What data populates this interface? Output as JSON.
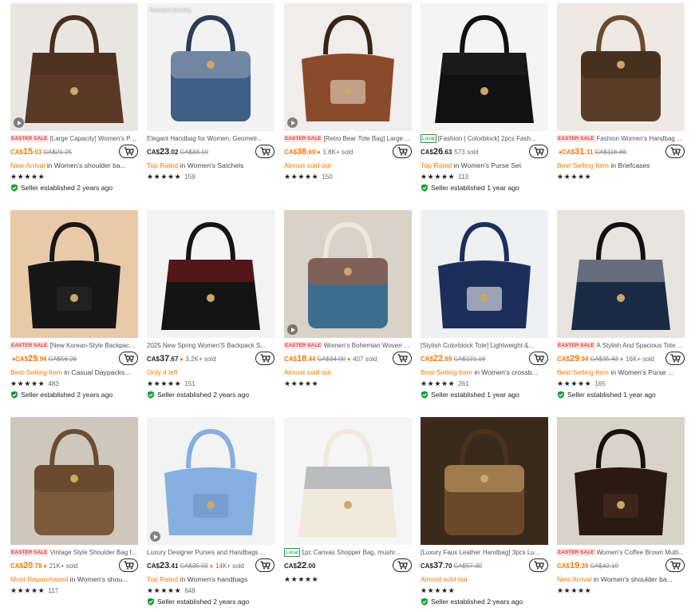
{
  "currency": "CA$",
  "colors": {
    "accent": "#fb7701",
    "sale": "#e4393c",
    "local": "#1a9b3a"
  },
  "products": [
    {
      "title": "[Large Capacity] Women's PU...",
      "badge": "EASTER SALE",
      "price_int": "15",
      "price_dec": ".03",
      "price_color": "orange",
      "orig": "CA$21.25",
      "sold": "",
      "flame": false,
      "ribbon_hl": "New Arrival",
      "ribbon_cat": " in Women's shoulder ba...",
      "reviews": "",
      "seller": "Seller established 2 years ago",
      "overlay": "",
      "video": true,
      "img": {
        "bg": "#e9e6e2",
        "bag": "#5a3a26",
        "pattern": "#3a2518",
        "handle": "#4a2e1e"
      }
    },
    {
      "title": "Elegant Handbag for Women, Geometr...",
      "badge": "",
      "price_int": "23",
      "price_dec": ".02",
      "price_color": "dark",
      "orig": "CA$33.10",
      "sold": "",
      "flame": false,
      "ribbon_hl": "Top Rated",
      "ribbon_cat": " in Women's Satchels",
      "reviews": "159",
      "seller": "",
      "overlay": "Random printing",
      "video": false,
      "img": {
        "bg": "#f2f2f2",
        "bag": "#3f5f86",
        "pattern": "#9aa7b8",
        "handle": "#2c3e55"
      }
    },
    {
      "title": "[Retro Bear Tote Bag] Large C...",
      "badge": "EASTER SALE",
      "price_int": "38",
      "price_dec": ".60",
      "price_color": "orange",
      "orig": "",
      "sold": "1.8K+ sold",
      "flame": true,
      "ribbon_hl": "Almost sold out",
      "ribbon_cat": "",
      "reviews": "150",
      "seller": "",
      "overlay": "",
      "video": true,
      "img": {
        "bg": "#efeeec",
        "bag": "#8a4b2c",
        "pattern": "#e6d9c5",
        "handle": "#3a2418"
      }
    },
    {
      "title": "[Fashion | Colorblock] 2pcs Fash...",
      "badge": "Local",
      "price_int": "26",
      "price_dec": ".63",
      "price_color": "dark",
      "orig": "",
      "sold": "573 sold",
      "flame": false,
      "ribbon_hl": "Top Rated",
      "ribbon_cat": " in Women's Purse Set",
      "reviews": "113",
      "seller": "Seller established 1 year ago",
      "overlay": "",
      "video": false,
      "img": {
        "bg": "#f4f4f4",
        "bag": "#111111",
        "pattern": "#2a2a2a",
        "handle": "#111111"
      }
    },
    {
      "title": "Fashion Women's Handbag S...",
      "badge": "EASTER SALE",
      "price_int": "31",
      "price_dec": ".31",
      "price_color": "orange",
      "orig": "CA$116.86",
      "sold": "",
      "flame": true,
      "ribbon_hl": "Best-Selling Item",
      "ribbon_cat": " in Briefcases",
      "reviews": "",
      "seller": "",
      "overlay": "",
      "video": false,
      "img": {
        "bg": "#efe9e3",
        "bag": "#5a3d28",
        "pattern": "#3b2718",
        "handle": "#6a4a30"
      }
    },
    {
      "title": "[New Korean-Style Backpack]...",
      "badge": "EASTER SALE",
      "price_int": "25",
      "price_dec": ".94",
      "price_color": "orange",
      "orig": "CA$56.26",
      "sold": "",
      "flame": true,
      "ribbon_hl": "Best-Selling Item",
      "ribbon_cat": " in Casual Daypacks...",
      "reviews": "483",
      "seller": "Seller established 2 years ago",
      "overlay": "",
      "video": false,
      "img": {
        "bg": "#e8c9a8",
        "bag": "#161616",
        "pattern": "#2a2a2a",
        "handle": "#161616"
      }
    },
    {
      "title": "2025 New Spring Women'S Backpack S...",
      "badge": "",
      "price_int": "37",
      "price_dec": ".67",
      "price_color": "dark",
      "orig": "",
      "sold": "3.2K+ sold",
      "flame": true,
      "ribbon_hl": "Only 4 left",
      "ribbon_cat": "",
      "reviews": "151",
      "seller": "Seller established 2 years ago",
      "overlay": "",
      "video": false,
      "img": {
        "bg": "#f3f3f3",
        "bag": "#141414",
        "pattern": "#c81e1e",
        "handle": "#141414"
      }
    },
    {
      "title": "Women's Bohemian Woven S...",
      "badge": "EASTER SALE",
      "price_int": "18",
      "price_dec": ".44",
      "price_color": "orange",
      "orig": "CA$34.00",
      "sold": "407 sold",
      "flame": true,
      "ribbon_hl": "Almost sold out",
      "ribbon_cat": "",
      "reviews": "",
      "seller": "",
      "overlay": "",
      "video": true,
      "img": {
        "bg": "#d8d2c8",
        "bag": "#3c6e8f",
        "pattern": "#b5552e",
        "handle": "#efe8da"
      }
    },
    {
      "title": "[Stylish Colorblock Tote] Lightweight &...",
      "badge": "",
      "price_int": "22",
      "price_dec": ".89",
      "price_color": "orange",
      "orig": "CA$121.16",
      "sold": "",
      "flame": false,
      "ribbon_hl": "Best-Selling Item",
      "ribbon_cat": " in Women's crossb...",
      "reviews": "261",
      "seller": "Seller established 1 year ago",
      "overlay": "",
      "video": false,
      "img": {
        "bg": "#eef0f2",
        "bag": "#1c2f5a",
        "pattern": "#f2f2f2",
        "handle": "#1c2f5a"
      }
    },
    {
      "title": "A Stylish And Spacious Tote ...",
      "badge": "EASTER SALE",
      "price_int": "29",
      "price_dec": ".94",
      "price_color": "orange",
      "orig": "CA$35.43",
      "sold": "16K+ sold",
      "flame": true,
      "ribbon_hl": "Best-Selling Item",
      "ribbon_cat": " in Women's Purse ...",
      "reviews": "165",
      "seller": "Seller established 1 year ago",
      "overlay": "",
      "video": false,
      "img": {
        "bg": "#e7e3de",
        "bag": "#1b2a44",
        "pattern": "#f0ede8",
        "handle": "#111111"
      }
    },
    {
      "title": "Vintage Style Shoulder Bag f...",
      "badge": "EASTER SALE",
      "price_int": "20",
      "price_dec": ".78",
      "price_color": "orange",
      "orig": "",
      "sold": "21K+ sold",
      "flame": true,
      "ribbon_hl": "Most Repurchased",
      "ribbon_cat": " in Women's shou...",
      "reviews": "117",
      "seller": "",
      "overlay": "",
      "video": false,
      "img": {
        "bg": "#cfc6bc",
        "bag": "#7a5a3a",
        "pattern": "#5c4028",
        "handle": "#6a4d32"
      }
    },
    {
      "title": "Luxury Designer Purses and Handbags ...",
      "badge": "",
      "price_int": "23",
      "price_dec": ".41",
      "price_color": "dark",
      "orig": "CA$35.02",
      "sold": "14K+ sold",
      "flame": true,
      "ribbon_hl": "Top Rated",
      "ribbon_cat": " in Women's handbags",
      "reviews": "648",
      "seller": "Seller established 2 years ago",
      "overlay": "",
      "video": true,
      "img": {
        "bg": "#f3f3f3",
        "bag": "#86aede",
        "pattern": "#6c92c4",
        "handle": "#86aede"
      }
    },
    {
      "title": "1pc Canvas Shopper Bag, mushr...",
      "badge": "Local",
      "price_int": "22",
      "price_dec": ".00",
      "price_color": "dark",
      "orig": "",
      "sold": "",
      "flame": false,
      "ribbon_hl": "",
      "ribbon_cat": "",
      "reviews": "",
      "seller": "",
      "overlay": "",
      "video": false,
      "img": {
        "bg": "#f5f5f5",
        "bag": "#efe9dc",
        "pattern": "#5a6b84",
        "handle": "#efe9dc"
      }
    },
    {
      "title": "[Luxury Faux Leather Handbag] 3pcs Lu...",
      "badge": "",
      "price_int": "37",
      "price_dec": ".70",
      "price_color": "dark",
      "orig": "CA$57.30",
      "sold": "",
      "flame": false,
      "ribbon_hl": "Almost sold out",
      "ribbon_cat": "",
      "reviews": "",
      "seller": "Seller established 2 years ago",
      "overlay": "",
      "video": false,
      "img": {
        "bg": "#3a2a1c",
        "bag": "#6b4a2a",
        "pattern": "#c9a56a",
        "handle": "#4a3220"
      }
    },
    {
      "title": "Women's Coffee Brown Multi...",
      "badge": "EASTER SALE",
      "price_int": "19",
      "price_dec": ".39",
      "price_color": "orange",
      "orig": "CA$42.10",
      "sold": "",
      "flame": false,
      "ribbon_hl": "New Arrival",
      "ribbon_cat": " in Women's shoulder ba...",
      "reviews": "",
      "seller": "",
      "overlay": "",
      "video": false,
      "img": {
        "bg": "#d9d2c8",
        "bag": "#2a1a12",
        "pattern": "#4a2e20",
        "handle": "#1a100a"
      }
    }
  ]
}
